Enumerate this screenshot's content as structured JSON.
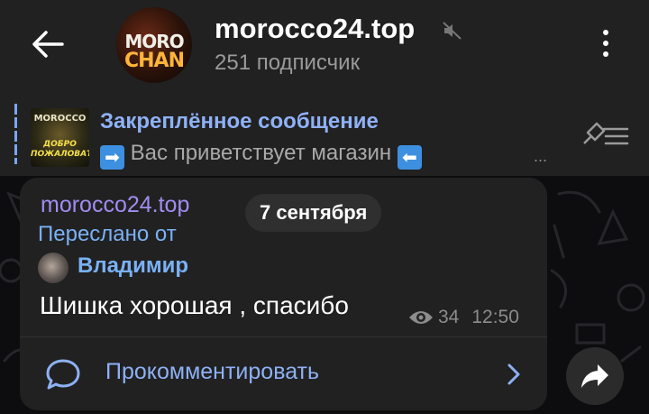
{
  "header": {
    "channel_name": "morocco24.top",
    "subscribers": "251 подписчик",
    "avatar_text_top": "MORO",
    "avatar_text_bottom": "CHAN"
  },
  "pinned": {
    "title": "Закреплённое сообщение",
    "text": "Вас приветствует магазин",
    "ellipsis": "...",
    "thumb_text_top": "MOROCCO",
    "thumb_text_mid": "ДОБРО",
    "thumb_text_bottom": "ПОЖАЛОВАТЬ"
  },
  "date_pill": "7 сентября",
  "message": {
    "author": "morocco24.top",
    "forwarded_label": "Переслано от",
    "forwarded_from": "Владимир",
    "text": "Шишка хорошая , спасибо",
    "views": "34",
    "time": "12:50"
  },
  "comment": {
    "label": "Прокомментировать"
  },
  "colors": {
    "background": "#0d0d0f",
    "panel": "#212121",
    "accent_blue": "#7ab1f5",
    "author_purple": "#a18cf0",
    "muted": "#8c8c8c"
  },
  "icons": {
    "back": "arrow-left-icon",
    "mute": "mute-icon",
    "menu": "more-vertical-icon",
    "pinned_list": "pin-list-icon",
    "views": "eye-icon",
    "comment": "comment-bubble-icon",
    "chevron": "chevron-right-icon",
    "share": "share-icon"
  }
}
